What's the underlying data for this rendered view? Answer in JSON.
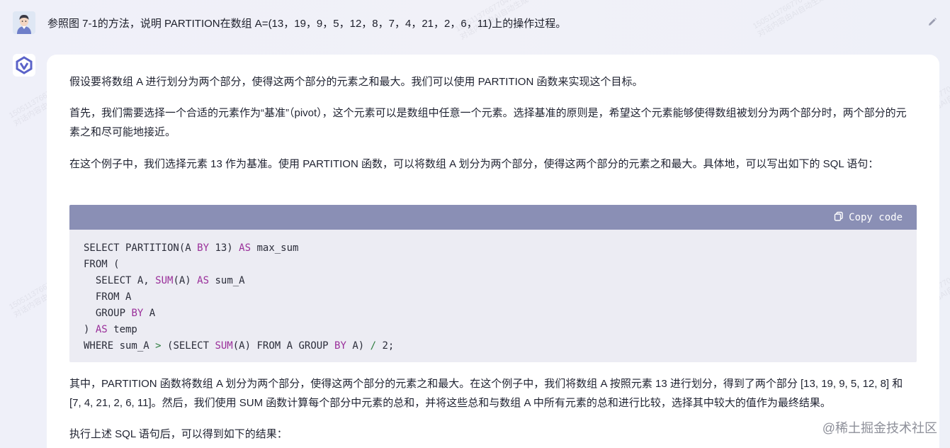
{
  "user_message": {
    "text": "参照图 7-1的方法，说明 PARTITION在数组 A=(13，19，9，5，12，8，7，4，21，2，6，11)上的操作过程。"
  },
  "assistant_message": {
    "paragraphs": [
      "假设要将数组 A 进行划分为两个部分，使得这两个部分的元素之和最大。我们可以使用 PARTITION 函数来实现这个目标。",
      "首先，我们需要选择一个合适的元素作为“基准”（pivot），这个元素可以是数组中任意一个元素。选择基准的原则是，希望这个元素能够使得数组被划分为两个部分时，两个部分的元素之和尽可能地接近。",
      "在这个例子中，我们选择元素 13 作为基准。使用 PARTITION 函数，可以将数组 A 划分为两个部分，使得这两个部分的元素之和最大。具体地，可以写出如下的 SQL 语句："
    ],
    "code": {
      "copy_label": "Copy code",
      "lines": [
        "SELECT PARTITION(A BY 13) AS max_sum",
        "FROM (",
        "  SELECT A, SUM(A) AS sum_A",
        "  FROM A",
        "  GROUP BY A",
        ") AS temp",
        "WHERE sum_A > (SELECT SUM(A) FROM A GROUP BY A) / 2;"
      ]
    },
    "after_paragraphs": [
      "其中，PARTITION 函数将数组 A 划分为两个部分，使得这两个部分的元素之和最大。在这个例子中，我们将数组 A 按照元素 13 进行划分，得到了两个部分 [13, 19, 9, 5, 12, 8] 和 [7, 4, 21, 2, 6, 11]。然后，我们使用 SUM 函数计算每个部分中元素的总和，并将这些总和与数组 A 中所有元素的总和进行比较，选择其中较大的值作为最终结果。",
      "执行上述 SQL 语句后，可以得到如下的结果："
    ]
  },
  "watermark": {
    "brand": "@稀土掘金技术社区",
    "line1": "15051137667704784",
    "line2": "对话内容由AI自动生成"
  },
  "icons": {
    "user_avatar": "user-avatar",
    "assistant_avatar": "assistant-logo-icon",
    "edit": "pencil-icon",
    "copy": "copy-icon"
  },
  "colors": {
    "code_header": "#8a8fb5",
    "code_bg": "#ececf3",
    "keyword": "#9a2f9a",
    "operator": "#2e7d3f"
  }
}
